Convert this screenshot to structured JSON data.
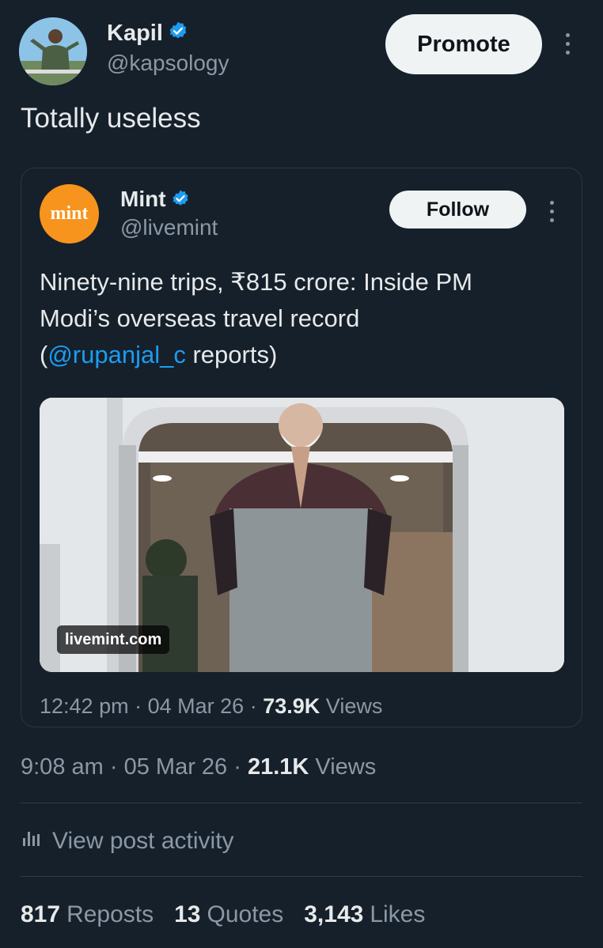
{
  "author": {
    "name": "Kapil",
    "handle": "@kapsology",
    "verified_icon": "verified-badge-icon",
    "promote_label": "Promote"
  },
  "post": {
    "text": "Totally useless",
    "time": "9:08 am",
    "date": "05 Mar 26",
    "views_count": "21.1K",
    "views_label": "Views",
    "activity_label": "View post activity"
  },
  "quoted": {
    "logo_text": "mint",
    "name": "Mint",
    "handle": "@livemint",
    "follow_label": "Follow",
    "text_line1": "Ninety-nine trips, ₹815 crore: Inside PM",
    "text_line2": "Modi’s overseas travel record",
    "text_open": "(",
    "mention": "@rupanjal_c",
    "text_close": " reports)",
    "media_watermark": "livemint.com",
    "time": "12:42 pm",
    "date": "04 Mar 26",
    "views_count": "73.9K",
    "views_label": "Views"
  },
  "stats": {
    "reposts_count": "817",
    "reposts_label": "Reposts",
    "quotes_count": "13",
    "quotes_label": "Quotes",
    "likes_count": "3,143",
    "likes_label": "Likes"
  },
  "separator": "·",
  "colors": {
    "background": "#15202b",
    "accent": "#1d9bf0",
    "muted": "#8b98a5",
    "mint_brand": "#f7941d"
  }
}
